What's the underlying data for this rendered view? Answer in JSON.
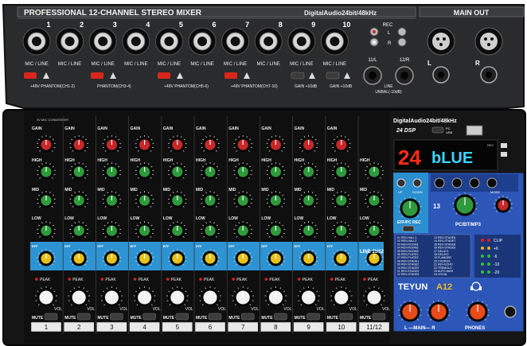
{
  "top_panel": {
    "title": "PROFESSIONAL 12-CHANNEL STEREO MIXER",
    "format": "DigitalAudio24bit/48kHz",
    "main_out_title": "MAIN OUT",
    "main_out_left": "L",
    "main_out_right": "R",
    "channel_numbers": [
      "1",
      "2",
      "3",
      "4",
      "5",
      "6",
      "7",
      "8",
      "9",
      "10"
    ],
    "jack_label": "MIC / LINE",
    "phantom_labels": [
      "+48V PHANTOM(CH1-2)",
      "PHANTOM(CH3-4)",
      "+48V PHANTOM(CH5-6)",
      "+48V PHANTOM(CH7-10)"
    ],
    "gain_labels": [
      "GAIN +10dB",
      "GAIN +10dB"
    ],
    "rec_label": "REC",
    "rec_l": "L",
    "rec_r": "R",
    "line_11": "11/L",
    "line_12": "12/R",
    "line_label": "LINE",
    "unbal_label": "UNBAL(-10dB)"
  },
  "channel_strip": {
    "mic_note": "3V MIC CONDENSER",
    "gain_label": "GAIN",
    "high_label": "HIGH",
    "mid_label": "MID",
    "low_label": "LOW",
    "eff_label": "EFF",
    "peak_label": "PEAK",
    "vol_label": "VOL",
    "mute_label": "MUTE",
    "line_1112_label": "LINE 11/12",
    "bottom_numbers": [
      "1",
      "2",
      "3",
      "4",
      "5",
      "6",
      "7",
      "8",
      "9",
      "10",
      "11/12"
    ]
  },
  "dsp": {
    "format": "DigitalAudio24bit/48kHz",
    "dsp_label": "24 DSP",
    "pc_label": "PC",
    "usb_label": "USB",
    "preset_number": "24",
    "display_text": "bLUE",
    "rec_label": "REC",
    "up_label": "UP",
    "down_label": "DOWN",
    "eff_rec_label": "EFF/PC REC",
    "pc_bt_mp3": "PC/BT/MP3",
    "channel_13": "13",
    "mode_label": "MODE",
    "effects": [
      "01 REV-HALL1",
      "02 REV-HALL2",
      "03 REV-ROOM1",
      "04 REV-ROOM2",
      "05 REV-ROOM3",
      "06 REV-PLATE1",
      "07 REV-PLATE2",
      "08 REV-STAGE1",
      "09 REV-STAGE2",
      "10 REV-STAGE3",
      "11 REV-STAGE4",
      "12 REV-STAGE5",
      "13 REV-STAGE6",
      "14 REV-STAGE7",
      "15 REV-STAGE8",
      "16 REV-STAGE9",
      "17 DELAY1",
      "18 DELAY2",
      "19 FLANGER",
      "20 CHORUS",
      "21 REV-ECHO",
      "22 TREMOLO",
      "23 AUTO-WAH",
      "24 VOCAL"
    ],
    "brand": "TEYUN",
    "model": "A12",
    "meter_labels": [
      "CLIP",
      "+6",
      "-6",
      "-10",
      "-20"
    ],
    "main_label": "L —MAIN— R",
    "phones_label": "PHONES"
  },
  "colors": {
    "panel": "#101010",
    "top_panel": "#2a2b2d",
    "gain_knob": "#c8282a",
    "eq_knob": "#2e9a3c",
    "eff_strip": "#2d93d2",
    "eff_knob": "#e8c21a",
    "dsp_panel": "#2c56b7",
    "display_red": "#ff2a1a",
    "display_cyan": "#37d6ff"
  }
}
